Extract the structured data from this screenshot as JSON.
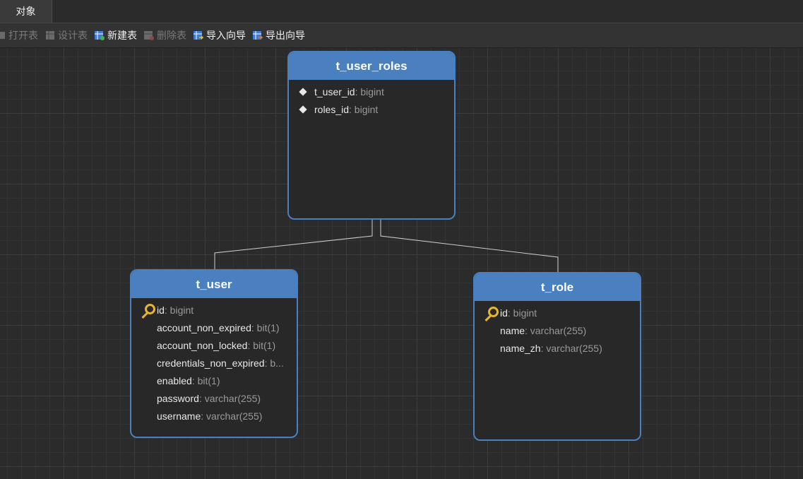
{
  "tab": {
    "label": "对象"
  },
  "toolbar": {
    "open": "打开表",
    "design": "设计表",
    "new": "新建表",
    "delete": "删除表",
    "import": "导入向导",
    "export": "导出向导"
  },
  "entities": {
    "user_roles": {
      "name": "t_user_roles",
      "fields": [
        {
          "name": "t_user_id",
          "type": ": bigint"
        },
        {
          "name": "roles_id",
          "type": ": bigint"
        }
      ]
    },
    "user": {
      "name": "t_user",
      "fields": [
        {
          "name": "id",
          "type": ": bigint"
        },
        {
          "name": "account_non_expired",
          "type": ": bit(1)"
        },
        {
          "name": "account_non_locked",
          "type": ": bit(1)"
        },
        {
          "name": "credentials_non_expired",
          "type": ": b..."
        },
        {
          "name": "enabled",
          "type": ": bit(1)"
        },
        {
          "name": "password",
          "type": ": varchar(255)"
        },
        {
          "name": "username",
          "type": ": varchar(255)"
        }
      ]
    },
    "role": {
      "name": "t_role",
      "fields": [
        {
          "name": "id",
          "type": ": bigint"
        },
        {
          "name": "name",
          "type": ": varchar(255)"
        },
        {
          "name": "name_zh",
          "type": ": varchar(255)"
        }
      ]
    }
  }
}
